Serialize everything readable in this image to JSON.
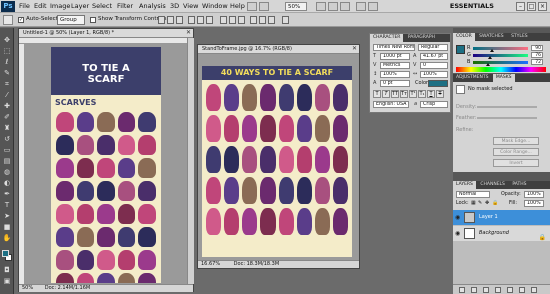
{
  "app": {
    "logo": "Ps",
    "workspace": "ESSENTIALS",
    "zoom": "50%"
  },
  "menu": [
    "File",
    "Edit",
    "Image",
    "Layer",
    "Select",
    "Filter",
    "Analysis",
    "3D",
    "View",
    "Window",
    "Help"
  ],
  "options": {
    "auto_select": "Auto-Select:",
    "auto_select_value": "Group",
    "transform_controls": "Show Transform Controls"
  },
  "doc1": {
    "title": "Untitled-1 @ 50% (Layer 1, RGB/8) *",
    "status": "Doc: 2.14M/1.16M",
    "zoom": "50%",
    "banner_top": "",
    "banner_line1": "TO TIE A",
    "banner_line2": "SCARF",
    "subtitle": "SCARVES"
  },
  "doc2": {
    "title": "StandToFrame.jpg @ 16.7% (RGB/8)",
    "status": "Doc: 18.3M/18.3M",
    "zoom": "16.67%",
    "banner": "40 WAYS TO TIE A SCARF"
  },
  "character": {
    "tabs": [
      "CHARACTER",
      "PARAGRAPH"
    ],
    "font": "Times New Roman",
    "style": "Regular",
    "size": "1000 pt",
    "leading": "41.67 pt",
    "kerning": "Metrics",
    "tracking": "0",
    "scale_v": "100%",
    "scale_h": "100%",
    "baseline": "0 pt",
    "color_label": "Color:",
    "language": "English: USA",
    "aa": "a",
    "aa_mode": "Crisp",
    "accent": "#1d6f83"
  },
  "color": {
    "tabs": [
      "COLOR",
      "SWATCHES",
      "STYLES"
    ],
    "channels": [
      {
        "name": "R",
        "value": "90",
        "fill": 0.35
      },
      {
        "name": "G",
        "value": "76",
        "fill": 0.3
      },
      {
        "name": "B",
        "value": "72",
        "fill": 0.28
      }
    ],
    "swatch": "#1d6f83"
  },
  "masks": {
    "tabs": [
      "ADJUSTMENTS",
      "MASKS"
    ],
    "status": "No mask selected",
    "density": "Density:",
    "feather": "Feather:",
    "refine": "Refine:",
    "btn_edge": "Mask Edge...",
    "btn_color": "Color Range...",
    "btn_invert": "Invert"
  },
  "layers": {
    "tabs": [
      "LAYERS",
      "CHANNELS",
      "PATHS"
    ],
    "blend": "Normal",
    "opacity_label": "Opacity:",
    "opacity": "100%",
    "lock_label": "Lock:",
    "fill_label": "Fill:",
    "fill": "100%",
    "items": [
      {
        "name": "Layer 1",
        "selected": true
      },
      {
        "name": "Background",
        "selected": false
      }
    ]
  }
}
